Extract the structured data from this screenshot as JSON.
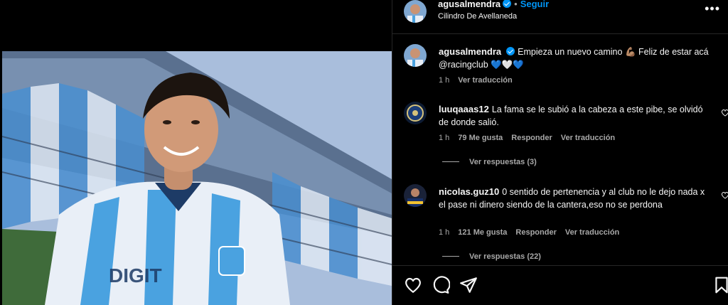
{
  "post": {
    "username": "agusalmendra",
    "follow_label": "Seguir",
    "dot": "•",
    "location": "Cilindro De Avellaneda",
    "more_label": "•••"
  },
  "caption": {
    "username": "agusalmendra",
    "text": "Empieza un nuevo camino 💪🏽 Feliz de estar acá @racingclub 💙🤍💙",
    "time": "1 h",
    "translate_label": "Ver traducción"
  },
  "comments": [
    {
      "username": "luuqaaas12",
      "text": "La fama se le subió a la cabeza a este pibe, se olvidó de donde salió.",
      "time": "1 h",
      "likes": "79 Me gusta",
      "reply_label": "Responder",
      "translate_label": "Ver traducción",
      "replies_label": "Ver respuestas (3)"
    },
    {
      "username": "nicolas.guz10",
      "text": "0 sentido de pertenencia y al club no le dejo nada x el pase ni dinero siendo de la cantera,eso no se perdona",
      "time": "1 h",
      "likes": "121 Me gusta",
      "reply_label": "Responder",
      "translate_label": "Ver traducción",
      "replies_label": "Ver respuestas (22)"
    }
  ],
  "icons": {
    "like": "heart-icon",
    "comment": "comment-icon",
    "share": "send-icon",
    "save": "bookmark-icon"
  },
  "colors": {
    "background": "#000000",
    "accent": "#0095f6",
    "muted": "#a8a8a8",
    "border": "#262626"
  }
}
